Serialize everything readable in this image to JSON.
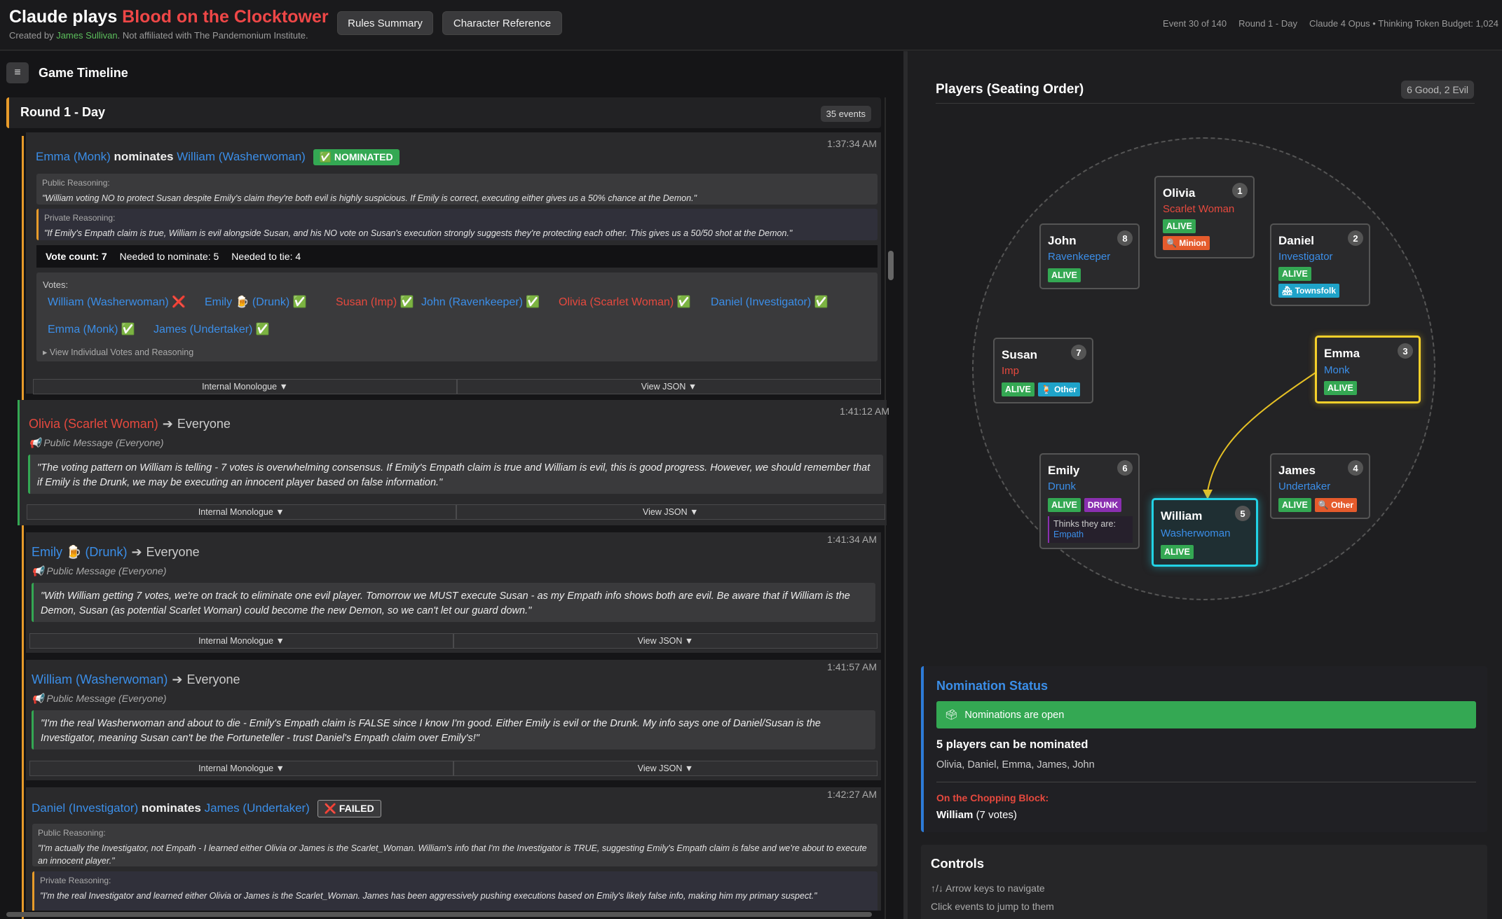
{
  "header": {
    "title_prefix": "Claude plays ",
    "title_accent": "Blood on the Clocktower",
    "sub_prefix": "Created by ",
    "sub_author": "James Sullivan",
    "sub_suffix": ". Not affiliated with The Pandemonium Institute.",
    "rules_btn": "Rules Summary",
    "character_btn": "Character Reference",
    "event_progress": "Event 30 of 140",
    "round": "Round 1 - Day",
    "model_info": "Claude 4 Opus • Thinking Token Budget: 1,024"
  },
  "timeline": {
    "menu_icon": "≡",
    "title": "Game Timeline",
    "round_title": "Round 1 - Day",
    "round_count": "35 events"
  },
  "events": {
    "e1": {
      "time": "1:37:34 AM",
      "nominator": "Emma",
      "nominator_role": "(Monk)",
      "verb": " nominates ",
      "nominee": "William",
      "nominee_role": "(Washerwoman)",
      "tag": "✅ NOMINATED",
      "public_title": "Public Reasoning:",
      "public_text": "\"William voting NO to protect Susan despite Emily's claim they're both evil is highly suspicious. If Emily is correct, executing either gives us a 50% chance at the Demon.\"",
      "private_title": "Private Reasoning:",
      "private_text": "\"If Emily's Empath claim is true, William is evil alongside Susan, and his NO vote on Susan's execution strongly suggests they're protecting each other. This gives us a 50/50 shot at the Demon.\"",
      "vote_count": "Vote count: 7",
      "needed_nominate": "Needed to nominate: 5",
      "needed_tie": "Needed to tie: 4",
      "votes_title": "Votes:",
      "votes": [
        "William (Washerwoman) ❌",
        "Emily 🍺 (Drunk) ✅",
        "Susan (Imp) ✅",
        "John (Ravenkeeper) ✅",
        "Olivia (Scarlet Woman) ✅",
        "Daniel (Investigator) ✅",
        "Emma (Monk) ✅",
        "James (Undertaker) ✅"
      ],
      "view_votes": "▸ View Individual Votes and Reasoning",
      "monologue_btn": "Internal Monologue  ▼",
      "json_btn": "View JSON  ▼"
    },
    "e2": {
      "time": "1:41:12 AM",
      "speaker": "Olivia",
      "speaker_role": "(Scarlet Woman)",
      "arrow": "➔",
      "target": "Everyone",
      "sub": "📢 Public Message (Everyone)",
      "quote": "\"The voting pattern on William is telling - 7 votes is overwhelming consensus. If Emily's Empath claim is true and William is evil, this is good progress. However, we should remember that if Emily is the Drunk, we may be executing an innocent player based on false information.\"",
      "monologue_btn": "Internal Monologue  ▼",
      "json_btn": "View JSON  ▼"
    },
    "e3": {
      "time": "1:41:34 AM",
      "speaker": "Emily 🍺",
      "speaker_role": "(Drunk)",
      "arrow": "➔",
      "target": "Everyone",
      "sub": "📢 Public Message (Everyone)",
      "quote": "\"With William getting 7 votes, we're on track to eliminate one evil player. Tomorrow we MUST execute Susan - as my Empath info shows both are evil. Be aware that if William is the Demon, Susan (as potential Scarlet Woman) could become the new Demon, so we can't let our guard down.\"",
      "monologue_btn": "Internal Monologue  ▼",
      "json_btn": "View JSON  ▼"
    },
    "e4": {
      "time": "1:41:57 AM",
      "speaker": "William",
      "speaker_role": "(Washerwoman)",
      "arrow": "➔",
      "target": "Everyone",
      "sub": "📢 Public Message (Everyone)",
      "quote": "\"I'm the real Washerwoman and about to die - Emily's Empath claim is FALSE since I know I'm good. Either Emily is evil or the Drunk. My info says one of Daniel/Susan is the Investigator, meaning Susan can't be the Fortuneteller - trust Daniel's Empath claim over Emily's!\"",
      "monologue_btn": "Internal Monologue  ▼",
      "json_btn": "View JSON  ▼"
    },
    "e5": {
      "time": "1:42:27 AM",
      "nominator": "Daniel",
      "nominator_role": "(Investigator)",
      "verb": " nominates ",
      "nominee": "James",
      "nominee_role": "(Undertaker)",
      "tag": "❌ FAILED",
      "public_title": "Public Reasoning:",
      "public_text": "\"I'm actually the Investigator, not Empath - I learned either Olivia or James is the Scarlet_Woman. William's info that I'm the Investigator is TRUE, suggesting Emily's Empath claim is false and we're about to execute an innocent player.\"",
      "private_title": "Private Reasoning:",
      "private_text": "\"I'm the real Investigator and learned either Olivia or James is the Scarlet_Woman. James has been aggressively pushing executions based on Emily's likely false info, making him my primary suspect.\""
    }
  },
  "players_panel": {
    "title": "Players (Seating Order)",
    "team_badge": "6 Good, 2 Evil",
    "alive": "ALIVE",
    "players": {
      "olivia": {
        "name": "Olivia",
        "num": "1",
        "role": "Scarlet Woman",
        "badge": "🔍 Minion"
      },
      "daniel": {
        "name": "Daniel",
        "num": "2",
        "role": "Investigator",
        "badge": "🏘 Townsfolk"
      },
      "emma": {
        "name": "Emma",
        "num": "3",
        "role": "Monk"
      },
      "james": {
        "name": "James",
        "num": "4",
        "role": "Undertaker",
        "badge": "🔍 Other"
      },
      "william": {
        "name": "William",
        "num": "5",
        "role": "Washerwoman"
      },
      "emily": {
        "name": "Emily",
        "num": "6",
        "role": "Drunk",
        "badge": "DRUNK",
        "thinks_label": "Thinks they are: ",
        "thinks_role": "Empath"
      },
      "susan": {
        "name": "Susan",
        "num": "7",
        "role": "Imp",
        "badge": "🍹 Other"
      },
      "john": {
        "name": "John",
        "num": "8",
        "role": "Ravenkeeper"
      }
    },
    "colors": {
      "good": "#3b8ee8",
      "evil": "#e6493e",
      "selected_nominator": "#f5d02a",
      "selected_nominee": "#22d3e6"
    }
  },
  "nomination": {
    "title": "Nomination Status",
    "open_icon": "🗳",
    "open_text": "Nominations are open",
    "count_text": "5 players can be nominated",
    "list": "Olivia, Daniel, Emma, James, John",
    "chop_label": "On the Chopping Block:",
    "chop_name": "William",
    "chop_votes": "(7 votes)"
  },
  "controls": {
    "title": "Controls",
    "line1": "↑/↓ Arrow keys to navigate",
    "line2": "Click events to jump to them"
  }
}
